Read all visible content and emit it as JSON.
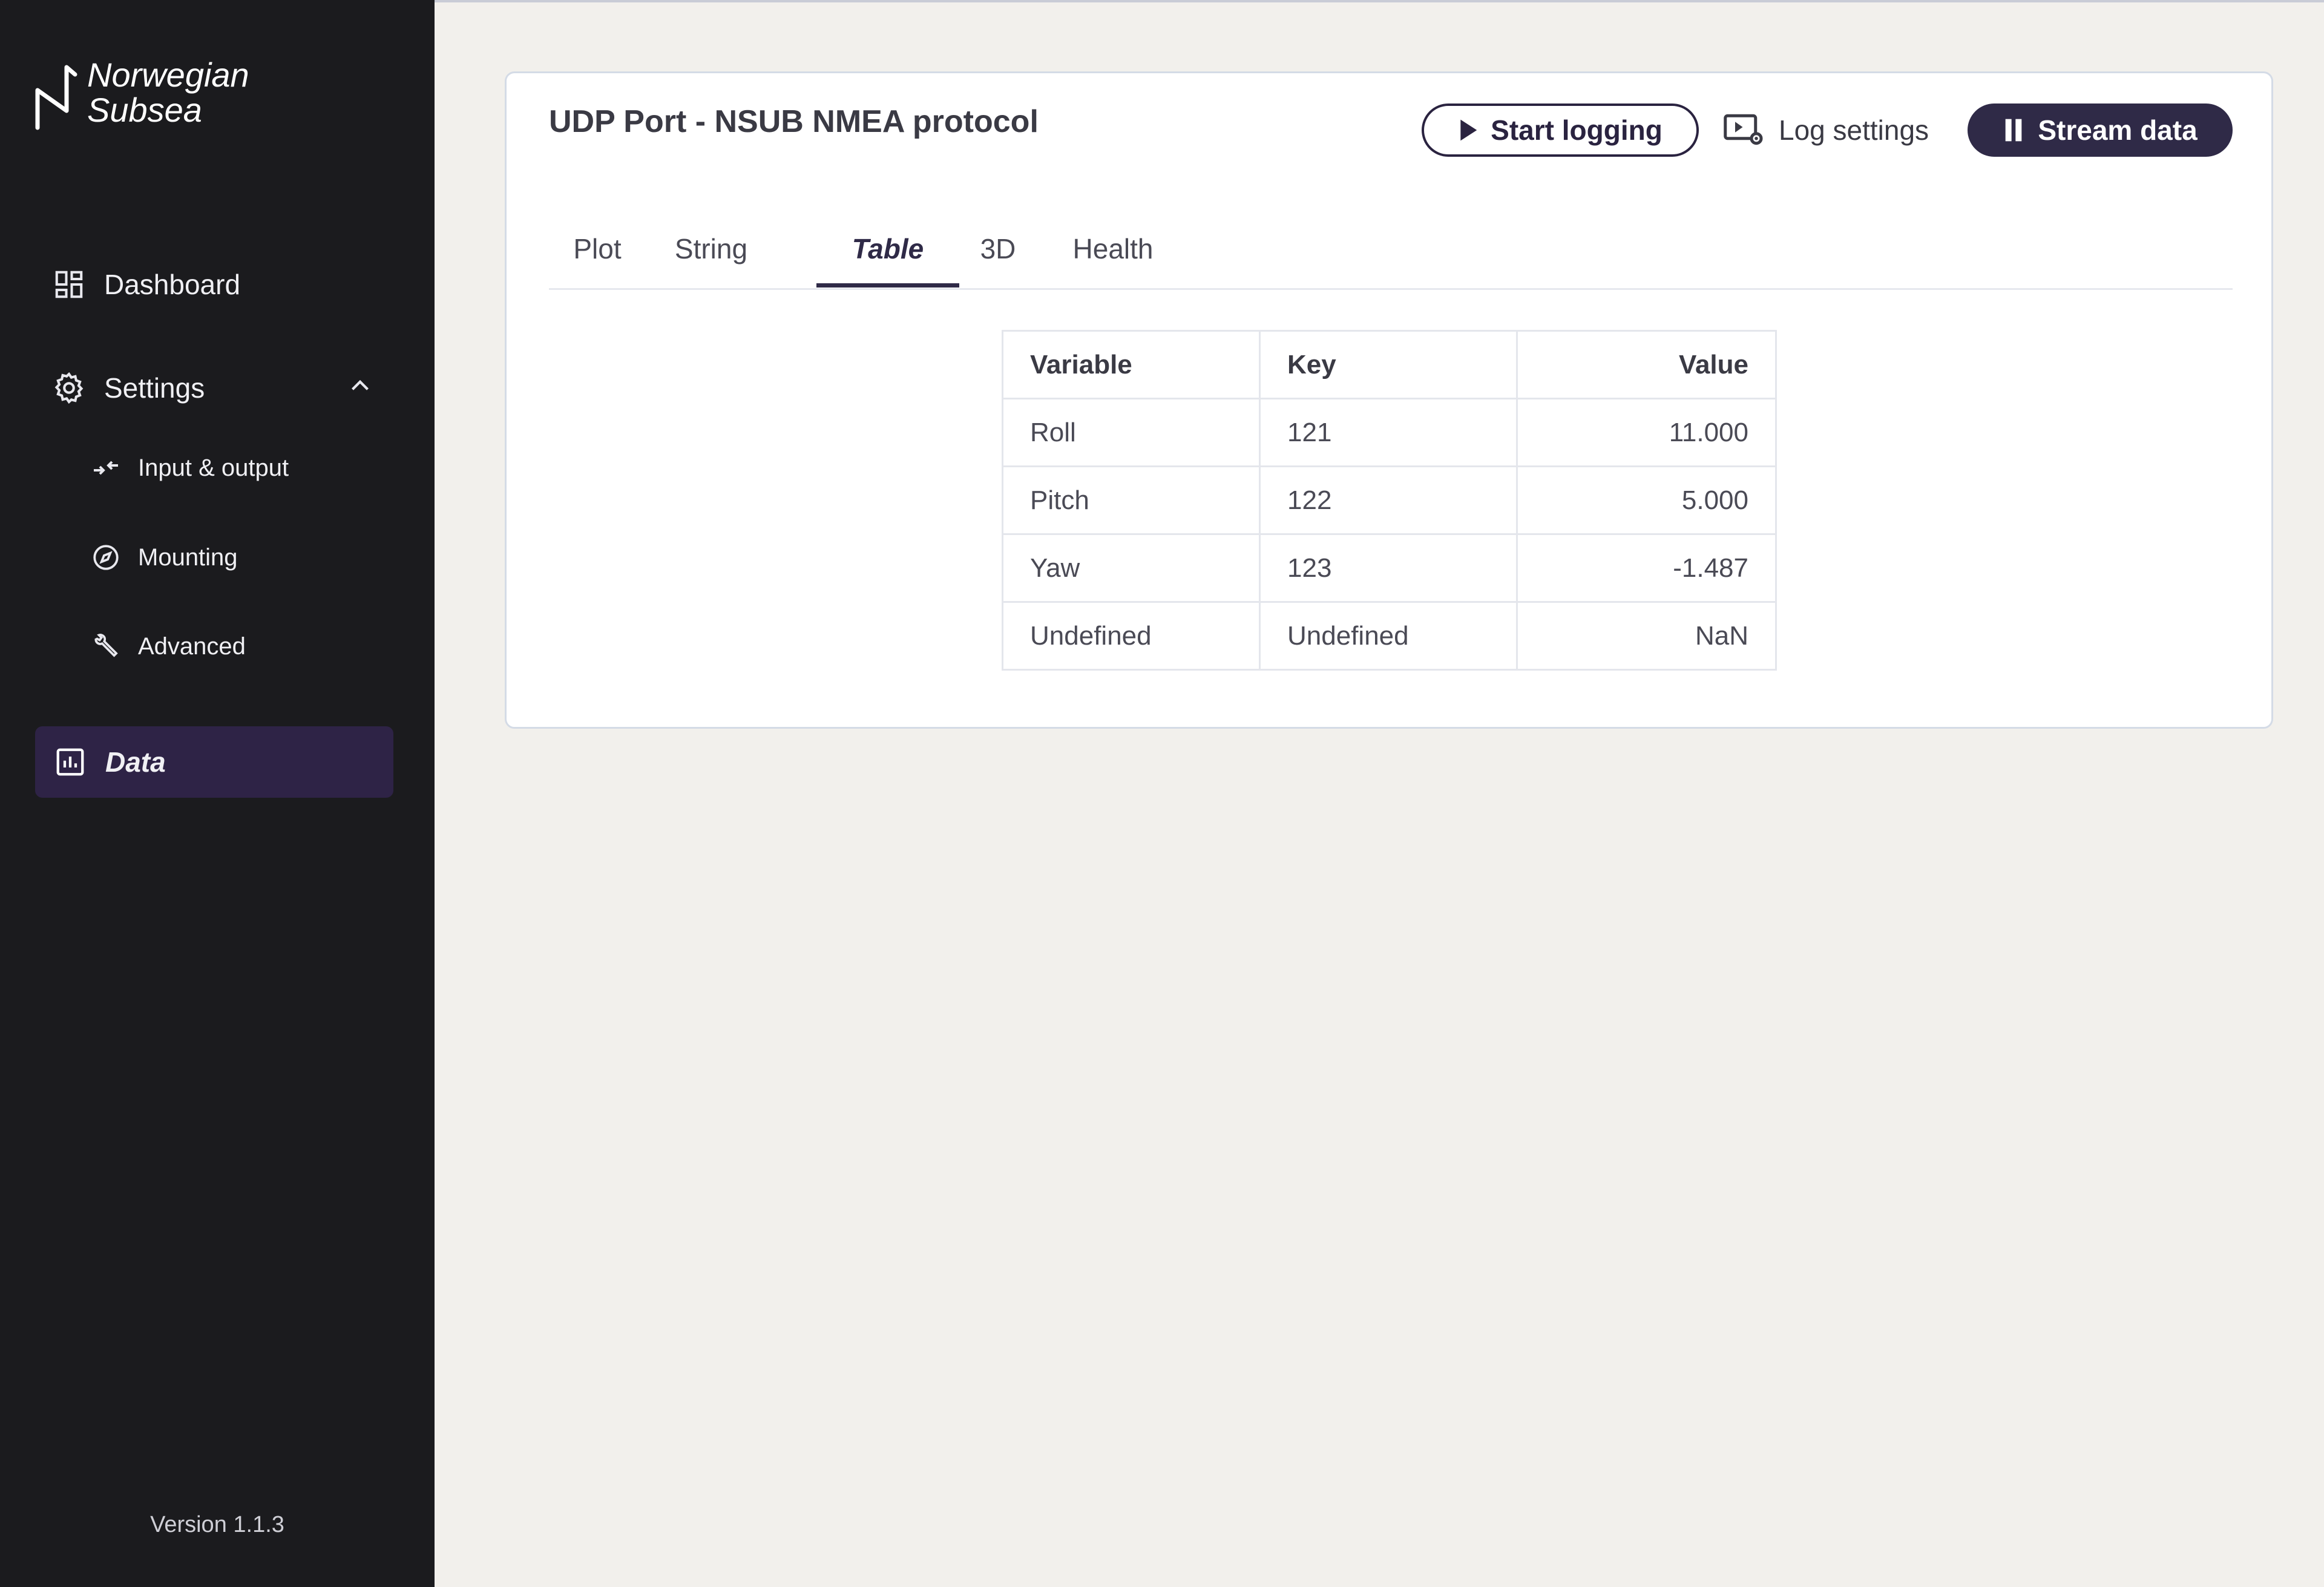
{
  "brand": {
    "line1": "Norwegian",
    "line2": "Subsea"
  },
  "sidebar": {
    "dashboard": {
      "label": "Dashboard",
      "icon": "dashboard-icon"
    },
    "settings": {
      "label": "Settings",
      "icon": "gear-icon",
      "expanded": true,
      "children": [
        {
          "label": "Input & output",
          "icon": "arrows-exchange-icon"
        },
        {
          "label": "Mounting",
          "icon": "compass-icon"
        },
        {
          "label": "Advanced",
          "icon": "wrench-icon"
        }
      ]
    },
    "data": {
      "label": "Data",
      "icon": "bar-chart-icon",
      "active": true
    },
    "version": "Version 1.1.3"
  },
  "card": {
    "title": "UDP Port - NSUB NMEA protocol",
    "buttons": {
      "start_logging": "Start logging",
      "log_settings": "Log settings",
      "stream_data": "Stream data"
    },
    "tabs": [
      "Plot",
      "String",
      "Table",
      "3D",
      "Health"
    ],
    "active_tab": "Table"
  },
  "table": {
    "headers": [
      "Variable",
      "Key",
      "Value"
    ],
    "rows": [
      [
        "Roll",
        "121",
        "11.000"
      ],
      [
        "Pitch",
        "122",
        "5.000"
      ],
      [
        "Yaw",
        "123",
        "-1.487"
      ],
      [
        "Undefined",
        "Undefined",
        "NaN"
      ]
    ]
  },
  "colors": {
    "sidebar_bg": "#1b1b1e",
    "active_nav_bg": "#2e2346",
    "accent": "#2f2a47",
    "page_bg": "#f2f0ec"
  }
}
